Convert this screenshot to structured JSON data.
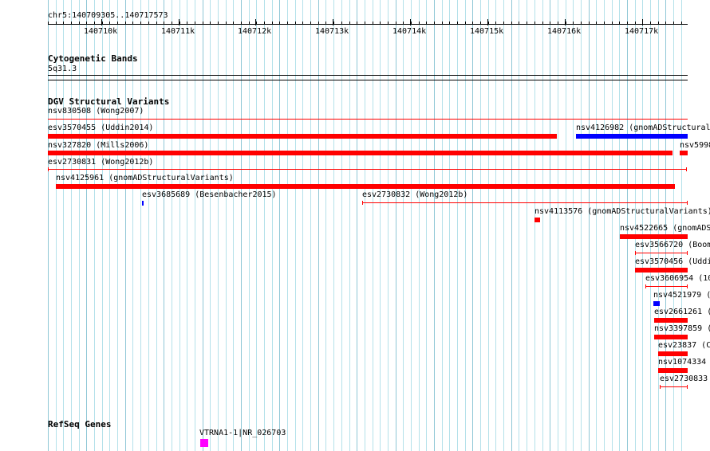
{
  "ruler": {
    "location": "chr5:140709305..140717573",
    "ticks": [
      "140710k",
      "140711k",
      "140712k",
      "140713k",
      "140714k",
      "140715k",
      "140716k",
      "140717k"
    ]
  },
  "cytoband": {
    "title": "Cytogenetic Bands",
    "band": "5q31.3"
  },
  "dgv": {
    "title": "DGV Structural Variants",
    "features": [
      {
        "label": "nsv830508 (Wong2007)",
        "color": "#ff0000",
        "kind": "line"
      },
      {
        "label": "esv3570455 (Uddin2014)",
        "color": "#ff0000",
        "kind": "bar"
      },
      {
        "label": "nsv4126982 (gnomADStructural",
        "color": "#0000ff",
        "kind": "bar"
      },
      {
        "label": "nsv327820 (Mills2006)",
        "color": "#ff0000",
        "kind": "bar"
      },
      {
        "label": "nsv5998",
        "color": "#ff0000",
        "kind": "bar"
      },
      {
        "label": "esv2730831 (Wong2012b)",
        "color": "#ff0000",
        "kind": "line"
      },
      {
        "label": "nsv4125961 (gnomADStructuralVariants)",
        "color": "#ff0000",
        "kind": "bar"
      },
      {
        "label": "esv3685689 (Besenbacher2015)",
        "color": "#0000ff",
        "kind": "bar"
      },
      {
        "label": "esv2730832 (Wong2012b)",
        "color": "#ff0000",
        "kind": "line"
      },
      {
        "label": "nsv4113576 (gnomADStructuralVariants)",
        "color": "#ff0000",
        "kind": "bar"
      },
      {
        "label": "nsv4522665 (gnomADS",
        "color": "#ff0000",
        "kind": "bar"
      },
      {
        "label": "esv3566720 (Boom",
        "color": "#ff0000",
        "kind": "line"
      },
      {
        "label": "esv3570456 (Uddi",
        "color": "#ff0000",
        "kind": "bar"
      },
      {
        "label": "esv3606954 (10",
        "color": "#ff0000",
        "kind": "line"
      },
      {
        "label": "nsv4521979 (",
        "color": "#0000ff",
        "kind": "bar"
      },
      {
        "label": "esv2661261 (",
        "color": "#ff0000",
        "kind": "bar"
      },
      {
        "label": "nsv3397859 (",
        "color": "#ff0000",
        "kind": "bar"
      },
      {
        "label": "esv23837 (C",
        "color": "#ff0000",
        "kind": "bar"
      },
      {
        "label": "nsv1074334",
        "color": "#ff0000",
        "kind": "bar"
      },
      {
        "label": "esv2730833",
        "color": "#ff0000",
        "kind": "line"
      }
    ]
  },
  "refseq": {
    "title": "RefSeq Genes",
    "features": [
      {
        "label": "VTRNA1-1|NR_026703",
        "color": "#ff00ff"
      }
    ]
  }
}
